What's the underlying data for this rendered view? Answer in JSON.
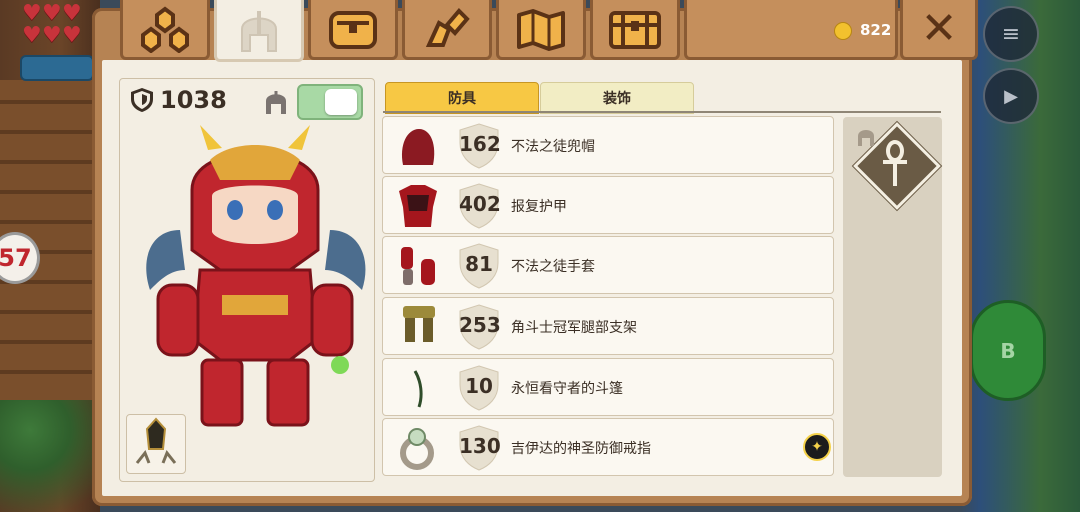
{
  "hud": {
    "coins": "822",
    "left_badge": "57",
    "b_button": "B"
  },
  "stats": {
    "total_armor": "1038"
  },
  "subtabs": {
    "armor": "防具",
    "decoration": "装饰"
  },
  "items": [
    {
      "value": "162",
      "name": "不法之徒兜帽"
    },
    {
      "value": "402",
      "name": "报复护甲"
    },
    {
      "value": "81",
      "name": "不法之徒手套"
    },
    {
      "value": "253",
      "name": "角斗士冠军腿部支架"
    },
    {
      "value": "10",
      "name": "永恒看守者的斗篷"
    },
    {
      "value": "130",
      "name": "吉伊达的神圣防御戒指"
    }
  ],
  "colors": {
    "active_tab": "#f7c844",
    "panel": "#b68353",
    "toggle_on": "#a8d9a5"
  }
}
